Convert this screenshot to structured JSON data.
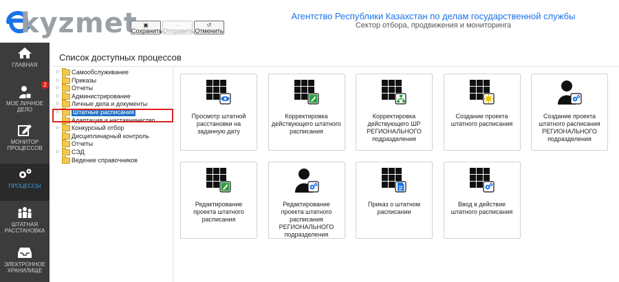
{
  "app": {
    "logo_text": "ekyzmet",
    "agency_line1": "Агентство Республики Казахстан по делам государственной службы",
    "agency_line2": "Сектор отбора, продвижения и мониторинга"
  },
  "toolbar": {
    "save_label": "Сохранить",
    "send_label": "Отправить",
    "cancel_label": "Отменить",
    "save_icon": "floppy-icon",
    "send_icon": "send-icon",
    "cancel_icon": "undo-icon"
  },
  "nav": {
    "items": [
      {
        "label": "ГЛАВНАЯ",
        "icon": "home-icon"
      },
      {
        "label": "МОЕ ЛИЧНОЕ ДЕЛО",
        "icon": "user-file-icon"
      },
      {
        "label": "МОНИТОР ПРОЦЕССОВ",
        "icon": "edit-icon"
      },
      {
        "label": "ПРОЦЕССЫ",
        "icon": "gears-icon",
        "active": true
      },
      {
        "label": "ШТАТНАЯ РАССТАНОВКА",
        "icon": "people-icon"
      },
      {
        "label": "ЭЛЕКТРОННОЕ ХРАНИЛИЩЕ",
        "icon": "inbox-icon"
      }
    ],
    "badge": "2"
  },
  "panel": {
    "title": "Список доступных процессов"
  },
  "tree": [
    {
      "label": "Самообслуживание",
      "expandable": true
    },
    {
      "label": "Приказы",
      "expandable": true
    },
    {
      "label": "Отчеты",
      "expandable": true
    },
    {
      "label": "Администрирование",
      "expandable": true
    },
    {
      "label": "Личные дела и документы",
      "expandable": true
    },
    {
      "label": "Штатные расписания",
      "expandable": true,
      "selected": true
    },
    {
      "label": "Адаптация и наставничество",
      "expandable": false
    },
    {
      "label": "Конкурсный отбор",
      "expandable": true
    },
    {
      "label": "Дисциплинарный контроль",
      "expandable": false
    },
    {
      "label": "Отчеты",
      "expandable": false
    },
    {
      "label": "СЭД",
      "expandable": true
    },
    {
      "label": "Ведение справочников",
      "expandable": false
    }
  ],
  "cards": [
    {
      "label": "Просмотр штатной расстановки на заданную дату",
      "icon": "grid-eye-icon"
    },
    {
      "label": "Корректировка действующего штатного расписания",
      "icon": "grid-edit-icon"
    },
    {
      "label": "Корректировка действующего ШР РЕГИОНАЛЬНОГО подразделения",
      "icon": "grid-sitemap-icon"
    },
    {
      "label": "Создание проекта штатного расписания",
      "icon": "grid-star-icon"
    },
    {
      "label": "Создание проекта штатного расписания РЕГИОНАЛЬНОГО подразделения",
      "icon": "user-gear-icon"
    },
    {
      "label": "Редактирование проекта штатного расписания",
      "icon": "grid-edit-icon"
    },
    {
      "label": "Редактирование проекта штатного расписания РЕГИОНАЛЬНОГО подразделения",
      "icon": "user-gear-icon"
    },
    {
      "label": "Приказ о штатном расписании",
      "icon": "grid-document-icon"
    },
    {
      "label": "Ввод в действие штатного расписания",
      "icon": "grid-gear-icon"
    }
  ],
  "colors": {
    "accent": "#1a73e8",
    "nav_bg": "#3c3c3c",
    "nav_active_text": "#3aa0e8",
    "selection": "#1f6fc5",
    "highlight_frame": "#e02020",
    "badge": "#d9241c"
  }
}
